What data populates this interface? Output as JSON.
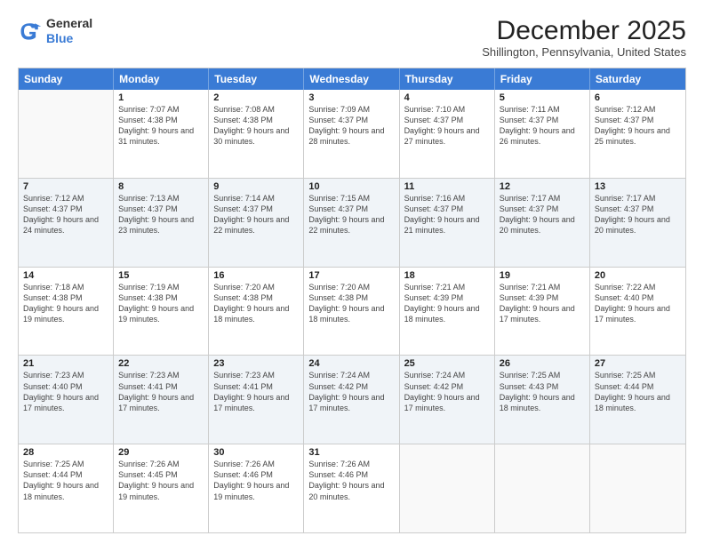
{
  "logo": {
    "general": "General",
    "blue": "Blue"
  },
  "header": {
    "month": "December 2025",
    "location": "Shillington, Pennsylvania, United States"
  },
  "days": [
    "Sunday",
    "Monday",
    "Tuesday",
    "Wednesday",
    "Thursday",
    "Friday",
    "Saturday"
  ],
  "rows": [
    [
      {
        "day": "",
        "sunrise": "",
        "sunset": "",
        "daylight": ""
      },
      {
        "day": "1",
        "sunrise": "Sunrise: 7:07 AM",
        "sunset": "Sunset: 4:38 PM",
        "daylight": "Daylight: 9 hours and 31 minutes."
      },
      {
        "day": "2",
        "sunrise": "Sunrise: 7:08 AM",
        "sunset": "Sunset: 4:38 PM",
        "daylight": "Daylight: 9 hours and 30 minutes."
      },
      {
        "day": "3",
        "sunrise": "Sunrise: 7:09 AM",
        "sunset": "Sunset: 4:37 PM",
        "daylight": "Daylight: 9 hours and 28 minutes."
      },
      {
        "day": "4",
        "sunrise": "Sunrise: 7:10 AM",
        "sunset": "Sunset: 4:37 PM",
        "daylight": "Daylight: 9 hours and 27 minutes."
      },
      {
        "day": "5",
        "sunrise": "Sunrise: 7:11 AM",
        "sunset": "Sunset: 4:37 PM",
        "daylight": "Daylight: 9 hours and 26 minutes."
      },
      {
        "day": "6",
        "sunrise": "Sunrise: 7:12 AM",
        "sunset": "Sunset: 4:37 PM",
        "daylight": "Daylight: 9 hours and 25 minutes."
      }
    ],
    [
      {
        "day": "7",
        "sunrise": "Sunrise: 7:12 AM",
        "sunset": "Sunset: 4:37 PM",
        "daylight": "Daylight: 9 hours and 24 minutes."
      },
      {
        "day": "8",
        "sunrise": "Sunrise: 7:13 AM",
        "sunset": "Sunset: 4:37 PM",
        "daylight": "Daylight: 9 hours and 23 minutes."
      },
      {
        "day": "9",
        "sunrise": "Sunrise: 7:14 AM",
        "sunset": "Sunset: 4:37 PM",
        "daylight": "Daylight: 9 hours and 22 minutes."
      },
      {
        "day": "10",
        "sunrise": "Sunrise: 7:15 AM",
        "sunset": "Sunset: 4:37 PM",
        "daylight": "Daylight: 9 hours and 22 minutes."
      },
      {
        "day": "11",
        "sunrise": "Sunrise: 7:16 AM",
        "sunset": "Sunset: 4:37 PM",
        "daylight": "Daylight: 9 hours and 21 minutes."
      },
      {
        "day": "12",
        "sunrise": "Sunrise: 7:17 AM",
        "sunset": "Sunset: 4:37 PM",
        "daylight": "Daylight: 9 hours and 20 minutes."
      },
      {
        "day": "13",
        "sunrise": "Sunrise: 7:17 AM",
        "sunset": "Sunset: 4:37 PM",
        "daylight": "Daylight: 9 hours and 20 minutes."
      }
    ],
    [
      {
        "day": "14",
        "sunrise": "Sunrise: 7:18 AM",
        "sunset": "Sunset: 4:38 PM",
        "daylight": "Daylight: 9 hours and 19 minutes."
      },
      {
        "day": "15",
        "sunrise": "Sunrise: 7:19 AM",
        "sunset": "Sunset: 4:38 PM",
        "daylight": "Daylight: 9 hours and 19 minutes."
      },
      {
        "day": "16",
        "sunrise": "Sunrise: 7:20 AM",
        "sunset": "Sunset: 4:38 PM",
        "daylight": "Daylight: 9 hours and 18 minutes."
      },
      {
        "day": "17",
        "sunrise": "Sunrise: 7:20 AM",
        "sunset": "Sunset: 4:38 PM",
        "daylight": "Daylight: 9 hours and 18 minutes."
      },
      {
        "day": "18",
        "sunrise": "Sunrise: 7:21 AM",
        "sunset": "Sunset: 4:39 PM",
        "daylight": "Daylight: 9 hours and 18 minutes."
      },
      {
        "day": "19",
        "sunrise": "Sunrise: 7:21 AM",
        "sunset": "Sunset: 4:39 PM",
        "daylight": "Daylight: 9 hours and 17 minutes."
      },
      {
        "day": "20",
        "sunrise": "Sunrise: 7:22 AM",
        "sunset": "Sunset: 4:40 PM",
        "daylight": "Daylight: 9 hours and 17 minutes."
      }
    ],
    [
      {
        "day": "21",
        "sunrise": "Sunrise: 7:23 AM",
        "sunset": "Sunset: 4:40 PM",
        "daylight": "Daylight: 9 hours and 17 minutes."
      },
      {
        "day": "22",
        "sunrise": "Sunrise: 7:23 AM",
        "sunset": "Sunset: 4:41 PM",
        "daylight": "Daylight: 9 hours and 17 minutes."
      },
      {
        "day": "23",
        "sunrise": "Sunrise: 7:23 AM",
        "sunset": "Sunset: 4:41 PM",
        "daylight": "Daylight: 9 hours and 17 minutes."
      },
      {
        "day": "24",
        "sunrise": "Sunrise: 7:24 AM",
        "sunset": "Sunset: 4:42 PM",
        "daylight": "Daylight: 9 hours and 17 minutes."
      },
      {
        "day": "25",
        "sunrise": "Sunrise: 7:24 AM",
        "sunset": "Sunset: 4:42 PM",
        "daylight": "Daylight: 9 hours and 17 minutes."
      },
      {
        "day": "26",
        "sunrise": "Sunrise: 7:25 AM",
        "sunset": "Sunset: 4:43 PM",
        "daylight": "Daylight: 9 hours and 18 minutes."
      },
      {
        "day": "27",
        "sunrise": "Sunrise: 7:25 AM",
        "sunset": "Sunset: 4:44 PM",
        "daylight": "Daylight: 9 hours and 18 minutes."
      }
    ],
    [
      {
        "day": "28",
        "sunrise": "Sunrise: 7:25 AM",
        "sunset": "Sunset: 4:44 PM",
        "daylight": "Daylight: 9 hours and 18 minutes."
      },
      {
        "day": "29",
        "sunrise": "Sunrise: 7:26 AM",
        "sunset": "Sunset: 4:45 PM",
        "daylight": "Daylight: 9 hours and 19 minutes."
      },
      {
        "day": "30",
        "sunrise": "Sunrise: 7:26 AM",
        "sunset": "Sunset: 4:46 PM",
        "daylight": "Daylight: 9 hours and 19 minutes."
      },
      {
        "day": "31",
        "sunrise": "Sunrise: 7:26 AM",
        "sunset": "Sunset: 4:46 PM",
        "daylight": "Daylight: 9 hours and 20 minutes."
      },
      {
        "day": "",
        "sunrise": "",
        "sunset": "",
        "daylight": ""
      },
      {
        "day": "",
        "sunrise": "",
        "sunset": "",
        "daylight": ""
      },
      {
        "day": "",
        "sunrise": "",
        "sunset": "",
        "daylight": ""
      }
    ]
  ]
}
